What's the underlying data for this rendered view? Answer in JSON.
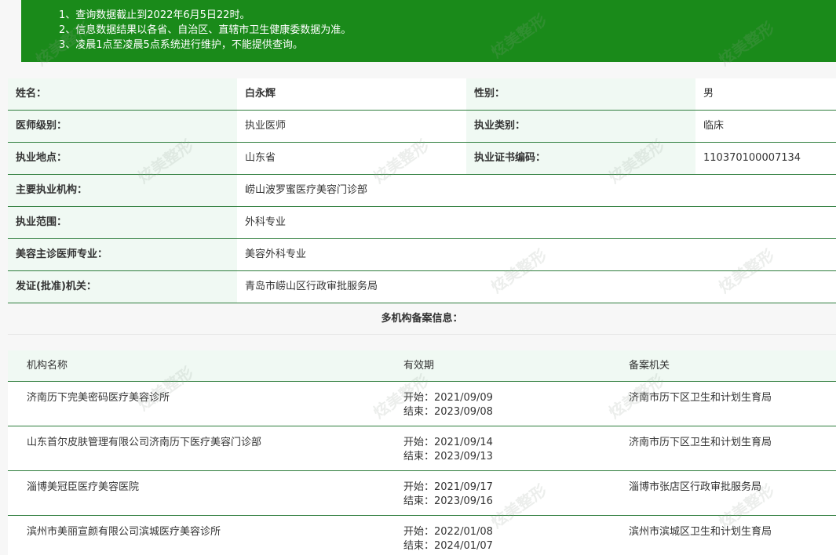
{
  "notice": {
    "lines": [
      "1、查询数据截止到2022年6月5日22时。",
      "2、信息数据结果以各省、自治区、直辖市卫生健康委数据为准。",
      "3、凌晨1点至凌晨5点系统进行维护，不能提供查询。"
    ]
  },
  "info": {
    "name_label": "姓名：",
    "name_value": "白永辉",
    "gender_label": "性别：",
    "gender_value": "男",
    "level_label": "医师级别：",
    "level_value": "执业医师",
    "category_label": "执业类别：",
    "category_value": "临床",
    "location_label": "执业地点：",
    "location_value": "山东省",
    "cert_label": "执业证书编码：",
    "cert_value": "110370100007134",
    "org_label": "主要执业机构：",
    "org_value": "崂山波罗蜜医疗美容门诊部",
    "scope_label": "执业范围：",
    "scope_value": "外科专业",
    "specialty_label": "美容主诊医师专业：",
    "specialty_value": "美容外科专业",
    "issuer_label": "发证(批准)机关：",
    "issuer_value": "青岛市崂山区行政审批服务局"
  },
  "multi": {
    "title": "多机构备案信息：",
    "headers": [
      "机构名称",
      "有效期",
      "备案机关"
    ],
    "rows": [
      {
        "org": "济南历下完美密码医疗美容诊所",
        "start": "开始：2021/09/09",
        "end": "结束：2023/09/08",
        "authority": "济南市历下区卫生和计划生育局"
      },
      {
        "org": "山东首尔皮肤管理有限公司济南历下医疗美容门诊部",
        "start": "开始：2021/09/14",
        "end": "结束：2023/09/13",
        "authority": "济南市历下区卫生和计划生育局"
      },
      {
        "org": "淄博美冠臣医疗美容医院",
        "start": "开始：2021/09/17",
        "end": "结束：2023/09/16",
        "authority": "淄博市张店区行政审批服务局"
      },
      {
        "org": "滨州市美丽宣颜有限公司滨城医疗美容诊所",
        "start": "开始：2022/01/08",
        "end": "结束：2024/01/07",
        "authority": "滨州市滨城区卫生和计划生育局"
      }
    ]
  },
  "watermark": "炫美整形",
  "colors": {
    "accent": "#1a8a1a",
    "border": "#2e7d3c",
    "label_bg": "#f0f9f3"
  }
}
